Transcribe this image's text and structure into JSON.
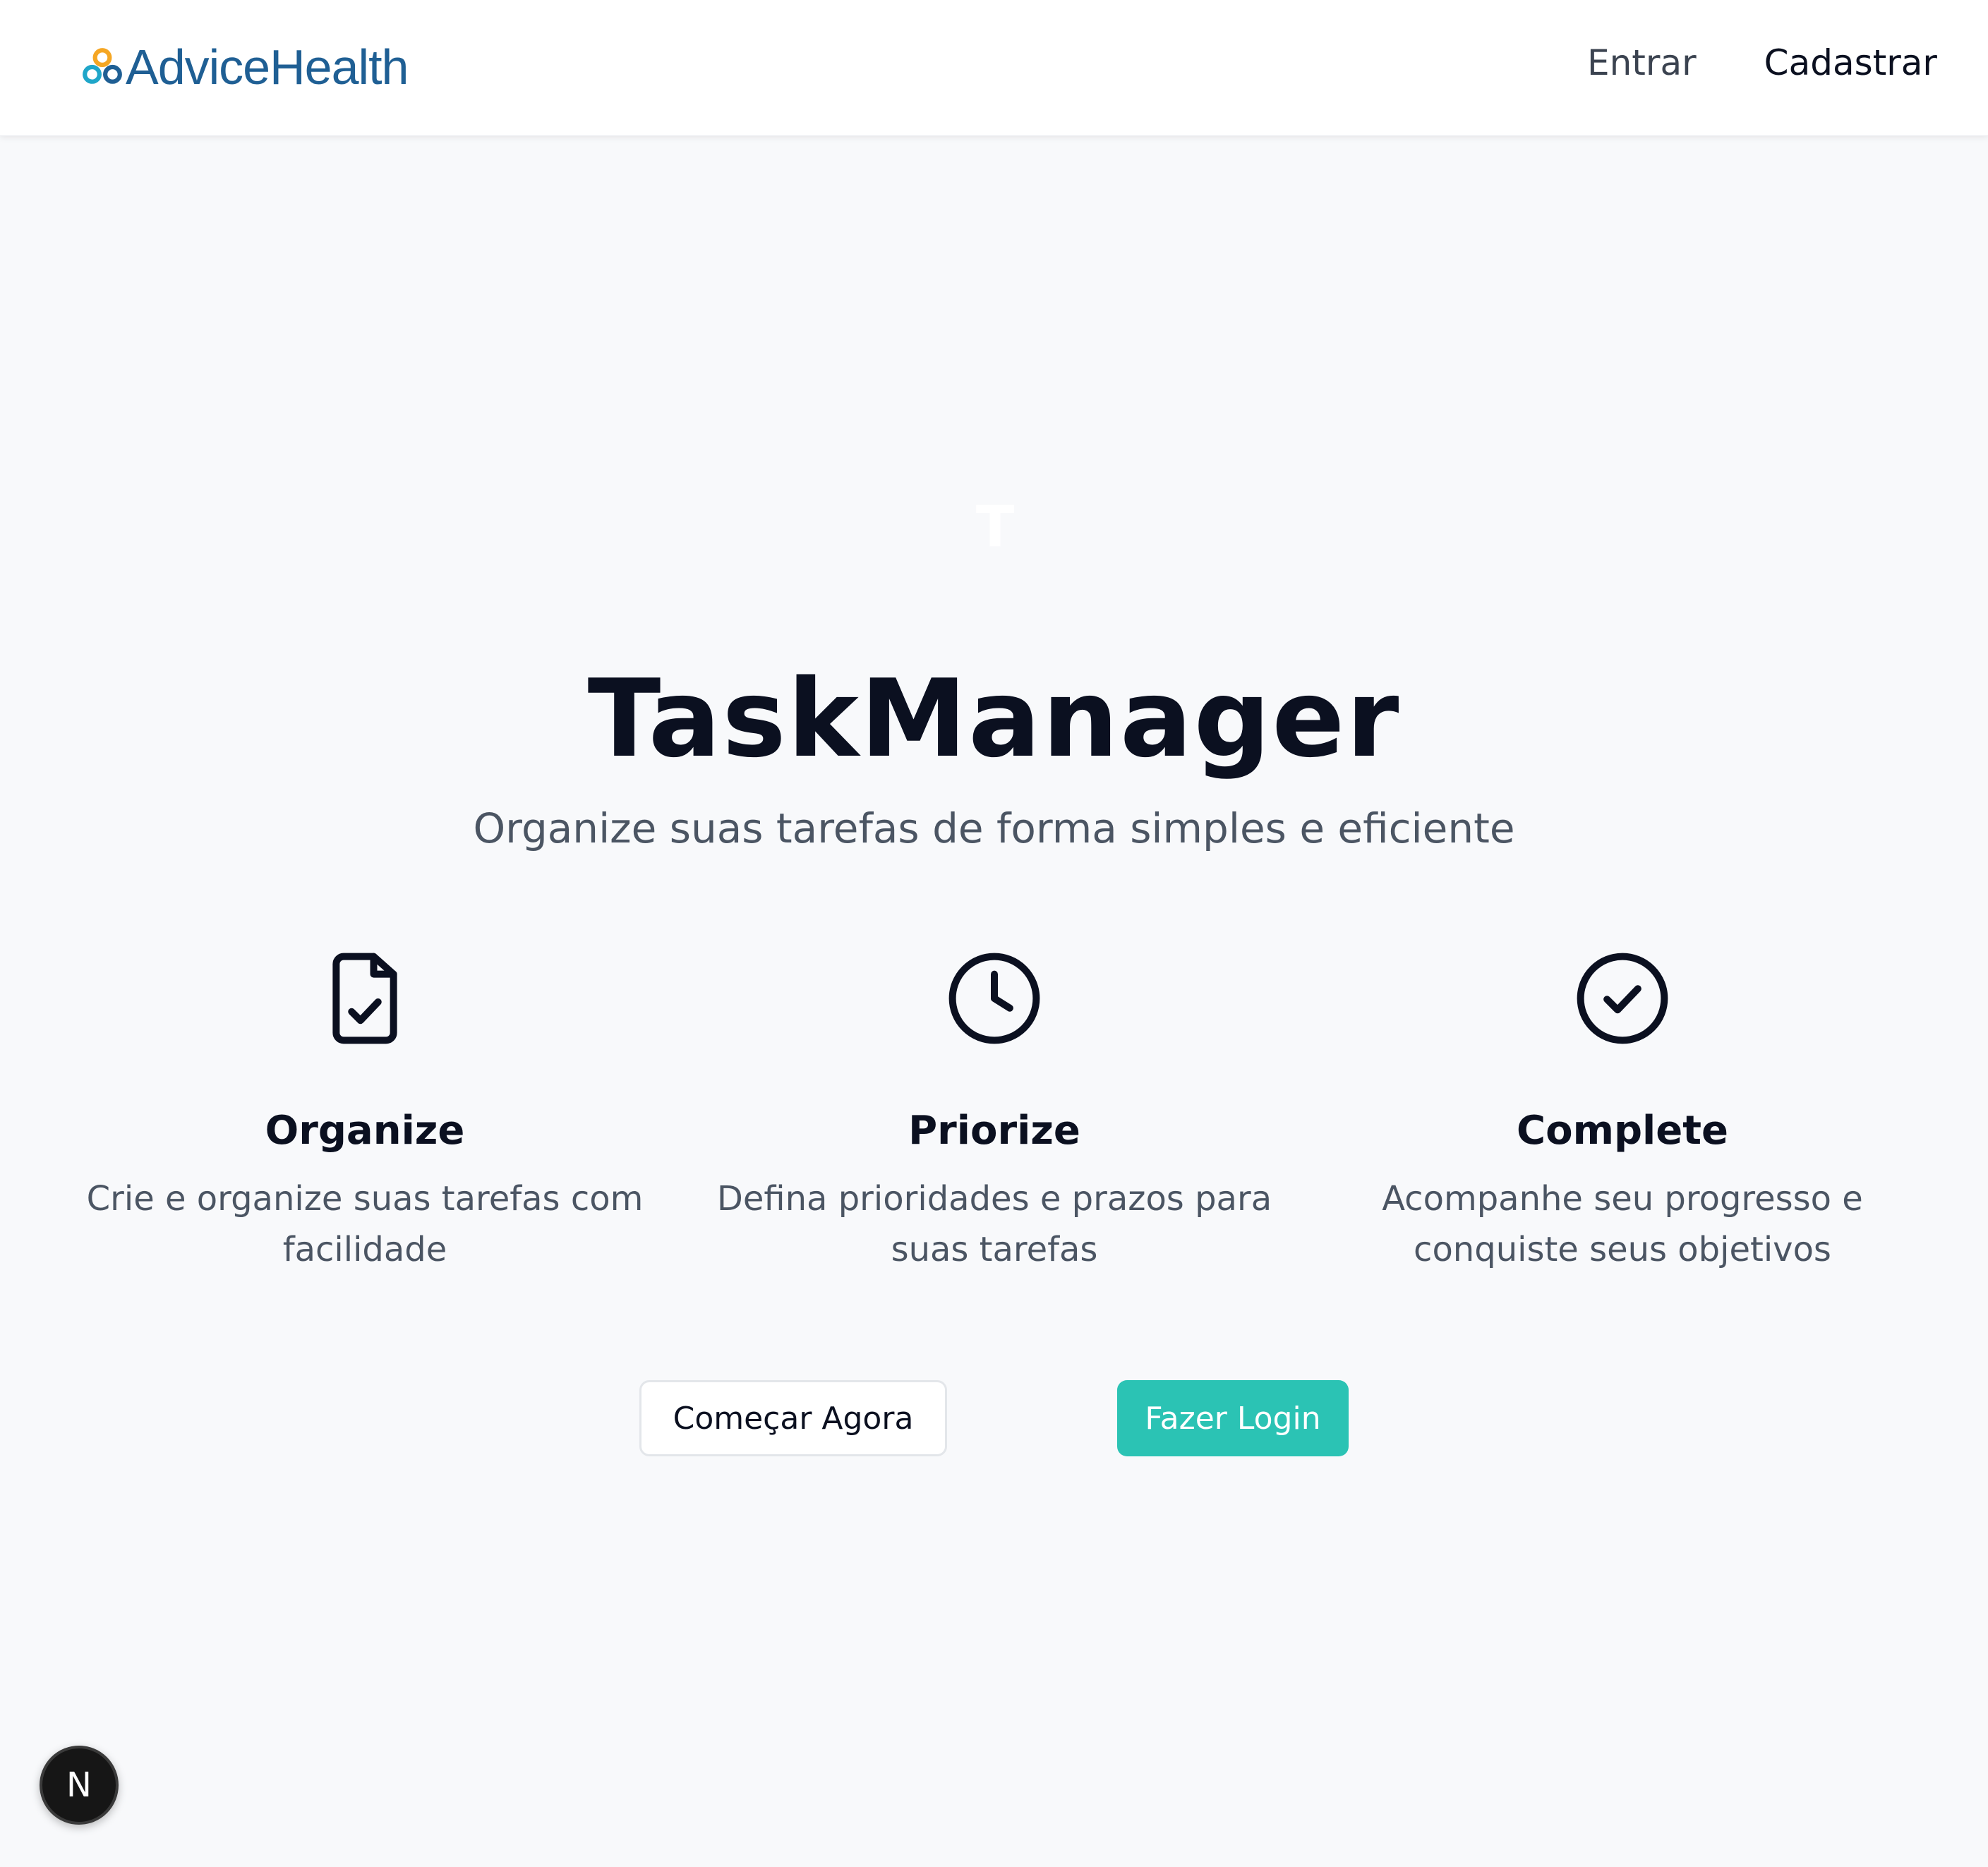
{
  "brand": {
    "name": "AdviceHealth",
    "logo_colors": [
      "#f5a623",
      "#1fa6c9",
      "#1f5f94"
    ]
  },
  "nav": {
    "login_label": "Entrar",
    "register_label": "Cadastrar"
  },
  "hero": {
    "logo_letter": "T",
    "title": "TaskManager",
    "subtitle": "Organize suas tarefas de forma simples e eficiente"
  },
  "features": [
    {
      "icon": "file-check-icon",
      "title": "Organize",
      "description": "Crie e organize suas tarefas com facilidade"
    },
    {
      "icon": "clock-icon",
      "title": "Priorize",
      "description": "Defina prioridades e prazos para suas tarefas"
    },
    {
      "icon": "check-circle-icon",
      "title": "Complete",
      "description": "Acompanhe seu progresso e conquiste seus objetivos"
    }
  ],
  "actions": {
    "start_label": "Começar Agora",
    "login_label": "Fazer Login"
  },
  "dev_badge": {
    "label": "N"
  },
  "colors": {
    "background": "#f8f9fb",
    "accent": "#2bc3b4",
    "text_primary": "#0b1020",
    "text_secondary": "#4b5563"
  }
}
